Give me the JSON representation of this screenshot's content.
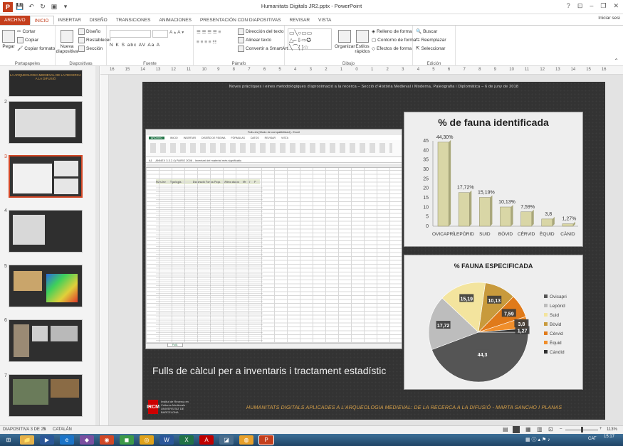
{
  "window": {
    "title": "Humanitats Digitals JR2.pptx - PowerPoint",
    "controls": [
      "?",
      "⊡",
      "–",
      "❐",
      "✕"
    ]
  },
  "ribbon_tabs": [
    "ARCHIVO",
    "INICIO",
    "INSERTAR",
    "DISEÑO",
    "TRANSICIONES",
    "ANIMACIONES",
    "PRESENTACIÓN CON DIAPOSITIVAS",
    "REVISAR",
    "VISTA"
  ],
  "signin": "Iniciar sesi",
  "ribbon": {
    "portapapeles": {
      "label": "Portapapeles",
      "paste": "Pegar",
      "cut": "Cortar",
      "copy": "Copiar",
      "format": "Copiar formato"
    },
    "diapositivas": {
      "label": "Diapositivas",
      "new_slide": "Nueva diapositiva",
      "design": "Diseño",
      "reset": "Restablecer",
      "section": "Sección"
    },
    "fuente": {
      "label": "Fuente",
      "styles": "N  K  S  abc  AV  Aa  A"
    },
    "parrafo": {
      "label": "Párrafo",
      "direction": "Dirección del texto",
      "align": "Alinear texto",
      "smartart": "Convertir a SmartArt"
    },
    "dibujo": {
      "label": "Dibujo",
      "organize": "Organizar",
      "quick_styles": "Estilos rápidos",
      "fill": "Relleno de forma",
      "outline": "Contorno de forma",
      "effects": "Efectos de forma"
    },
    "edicion": {
      "label": "Edición",
      "find": "Buscar",
      "replace": "Reemplazar",
      "select": "Seleccionar"
    }
  },
  "thumbnails": [
    {
      "num": "",
      "title": "LA ARQUEOLOGIA MEDIEVAL DE LA RECERCA A LA DIFUSIÓ"
    },
    {
      "num": "2"
    },
    {
      "num": "3"
    },
    {
      "num": "4"
    },
    {
      "num": "5"
    },
    {
      "num": "6"
    },
    {
      "num": "7"
    }
  ],
  "ruler_labels": [
    "16",
    "15",
    "14",
    "13",
    "12",
    "11",
    "10",
    "9",
    "8",
    "7",
    "6",
    "5",
    "4",
    "3",
    "2",
    "1",
    "0",
    "1",
    "2",
    "3",
    "4",
    "5",
    "6",
    "7",
    "8",
    "9",
    "10",
    "11",
    "12",
    "13",
    "14",
    "15",
    "16"
  ],
  "slide": {
    "header": "Noves pràctiques i eines metodològiques d'aproximació a la recerca – Secció d'Història Medieval i Moderna, Paleografia i Diplomàtica – 6 de juny de 2018",
    "caption": "Fulls de càlcul per a inventaris i tractament estadístic",
    "footer": "HUMANITATS DIGITALS APLICADES A L'ARQUEOLOGIA MEDIEVAL: DE LA RECERCA A LA DIFUSIÓ - MARTA SANCHO I PLANAS",
    "logo_seal": "IRCM",
    "logo_text": "Institut de Recerca en Cultures Medievals · UNIVERSITAT DE BARCELONA"
  },
  "excel": {
    "title": "Fulls.xls [Modo de compatibilidad] - Excel",
    "tabs": [
      "ARCHIVO",
      "INICIO",
      "INSERTAR",
      "DISEÑO DE PÁGINA",
      "FÓRMULAS",
      "DATOS",
      "REVISAR",
      "VISTA"
    ],
    "cellref": "A1",
    "formula": "ANNEX 3.3.2.4) PAIRO 2006 - Inventari del material més significatiu",
    "sheet_tab": "Full1",
    "header_row": [
      "Núm.Inv",
      "Tipologia",
      "Decoració",
      "Forma",
      "Peça",
      "Altres dades",
      "Mr",
      "V",
      "P"
    ]
  },
  "chart_data": [
    {
      "type": "bar",
      "title": "% de fauna identificada",
      "categories": [
        "OVICAPRÍ",
        "LEPÒRID",
        "SUID",
        "BÒVID",
        "CÈRVID",
        "ÈQUID",
        "CÀNID"
      ],
      "values": [
        44.3,
        17.72,
        15.19,
        10.13,
        7.59,
        3.8,
        1.27
      ],
      "labels": [
        "44,30%",
        "17,72%",
        "15,19%",
        "10,13%",
        "7,59%",
        "3,8",
        "1,27%"
      ],
      "ylim": [
        0,
        45
      ],
      "yticks": [
        "0",
        "5",
        "10",
        "15",
        "20",
        "25",
        "30",
        "35",
        "40",
        "45"
      ],
      "colors": {
        "face": "#d9d6a6",
        "side": "#a9a77a"
      }
    },
    {
      "type": "pie",
      "title": "% FAUNA ESPECIFICADA",
      "series": [
        {
          "name": "Ovicapri",
          "value": 44.3,
          "label": "44,3",
          "color": "#555555"
        },
        {
          "name": "Lepòrid",
          "value": 17.72,
          "label": "17,72",
          "color": "#bdbdbd"
        },
        {
          "name": "Suid",
          "value": 15.19,
          "label": "15,19",
          "color": "#f3e49e"
        },
        {
          "name": "Bòvid",
          "value": 10.13,
          "label": "10,13",
          "color": "#c89a3c"
        },
        {
          "name": "Cèrvid",
          "value": 7.59,
          "label": "7,59",
          "color": "#e07a1a"
        },
        {
          "name": "Èquid",
          "value": 3.8,
          "label": "3,8",
          "color": "#f08e2b"
        },
        {
          "name": "Càndid",
          "value": 1.27,
          "label": "1,27",
          "color": "#2f2f2f"
        }
      ],
      "legend_labels": [
        "Ovicapri",
        "Lepòrid",
        "Suid",
        "Bòvid",
        "Cèrvid",
        "Èquid",
        "Càndid"
      ],
      "legend_position": "right"
    }
  ],
  "statusbar": {
    "slide_info": "DIAPOSITIVA 3 DE 23",
    "language": "CATALÁN",
    "zoom": "113%"
  },
  "taskbar": {
    "time": "15:17",
    "lang": "CAT"
  }
}
